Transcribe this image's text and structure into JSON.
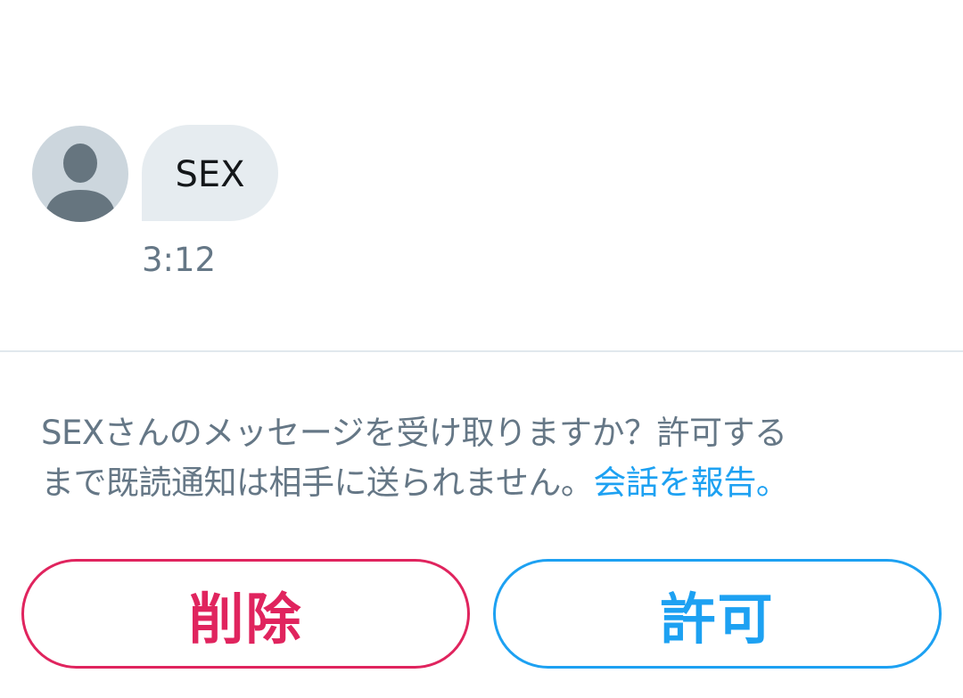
{
  "conversation": {
    "sender_avatar_icon": "default-profile-icon",
    "message": {
      "text": "SEX",
      "time": "3:12"
    }
  },
  "request": {
    "prompt_line1": "SEXさんのメッセージを受け取りますか？許可する",
    "prompt_line2": "まで既読通知は相手に送られません。",
    "report_link": "会話を報告。",
    "delete_label": "削除",
    "allow_label": "許可"
  },
  "colors": {
    "delete": "#e0245e",
    "allow": "#1da1f2",
    "link": "#1da1f2",
    "secondary_text": "#657786",
    "bubble": "#e6ecf0",
    "avatar_bg": "#ccd6dd"
  }
}
